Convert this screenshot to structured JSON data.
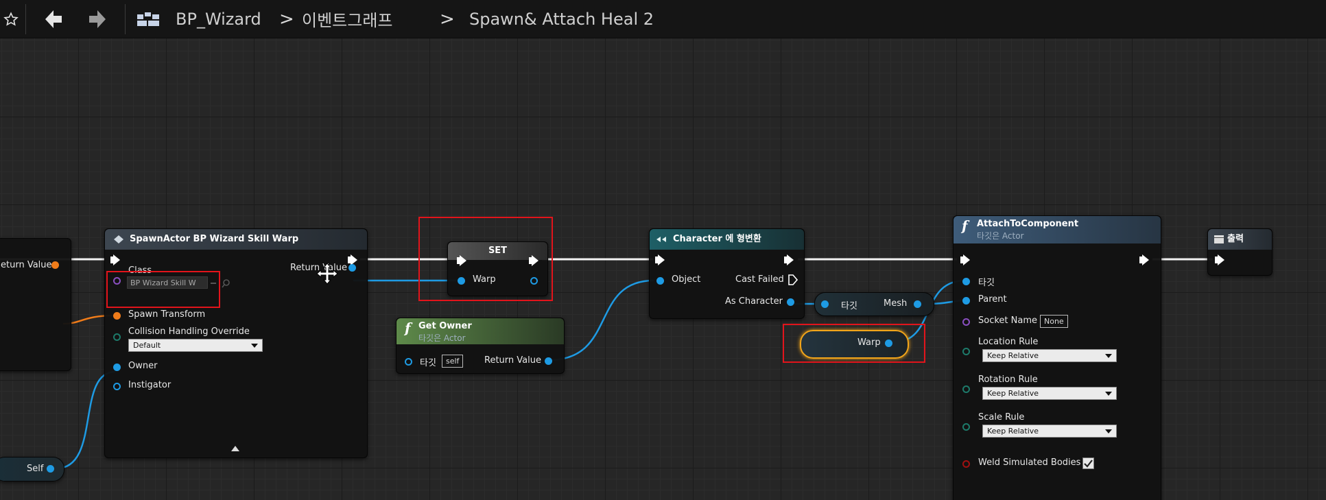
{
  "toolbar": {
    "breadcrumb_blueprint": "BP_Wizard",
    "breadcrumb_graph": "이벤트그래프",
    "breadcrumb_function": "Spawn& Attach Heal 2",
    "separator": ">"
  },
  "nodes": {
    "left_partial": {
      "return_value_label": "eturn Value"
    },
    "self_node": {
      "label": "Self"
    },
    "spawn_actor": {
      "title": "SpawnActor BP Wizard Skill Warp",
      "class_label": "Class",
      "class_value": "BP Wizard Skill W",
      "return_value_label": "Return Value",
      "spawn_transform_label": "Spawn Transform",
      "collision_label": "Collision Handling Override",
      "collision_value": "Default",
      "owner_label": "Owner",
      "instigator_label": "Instigator"
    },
    "set_node": {
      "title": "SET",
      "warp_label": "Warp"
    },
    "get_owner": {
      "title": "Get Owner",
      "subtitle": "타깃은 Actor",
      "target_label": "타깃",
      "target_value": "self",
      "return_value_label": "Return Value"
    },
    "cast_node": {
      "title": "Character 에 형변환",
      "object_label": "Object",
      "cast_failed_label": "Cast Failed",
      "as_character_label": "As Character"
    },
    "mesh_node": {
      "target_label": "타깃",
      "mesh_label": "Mesh"
    },
    "warp_var": {
      "label": "Warp"
    },
    "attach_node": {
      "title": "AttachToComponent",
      "subtitle": "타깃은 Actor",
      "target_label": "타깃",
      "parent_label": "Parent",
      "socket_label": "Socket Name",
      "socket_value": "None",
      "location_rule_label": "Location Rule",
      "location_rule_value": "Keep Relative",
      "rotation_rule_label": "Rotation Rule",
      "rotation_rule_value": "Keep Relative",
      "scale_rule_label": "Scale Rule",
      "scale_rule_value": "Keep Relative",
      "weld_label": "Weld Simulated Bodies",
      "weld_checked": true
    },
    "output_node": {
      "title": "출력"
    }
  },
  "colors": {
    "exec_wire": "#ffffff",
    "object_wire": "#1e9be4",
    "transform_pin": "#f07c1a",
    "highlight": "#e3141b",
    "selected_node": "#f2a51a"
  },
  "icons": [
    "star-icon",
    "back-arrow-icon",
    "forward-arrow-icon",
    "blueprint-grid-icon",
    "move-cursor-icon",
    "function-icon",
    "cast-icon",
    "output-icon",
    "checkbox-checked-icon"
  ]
}
